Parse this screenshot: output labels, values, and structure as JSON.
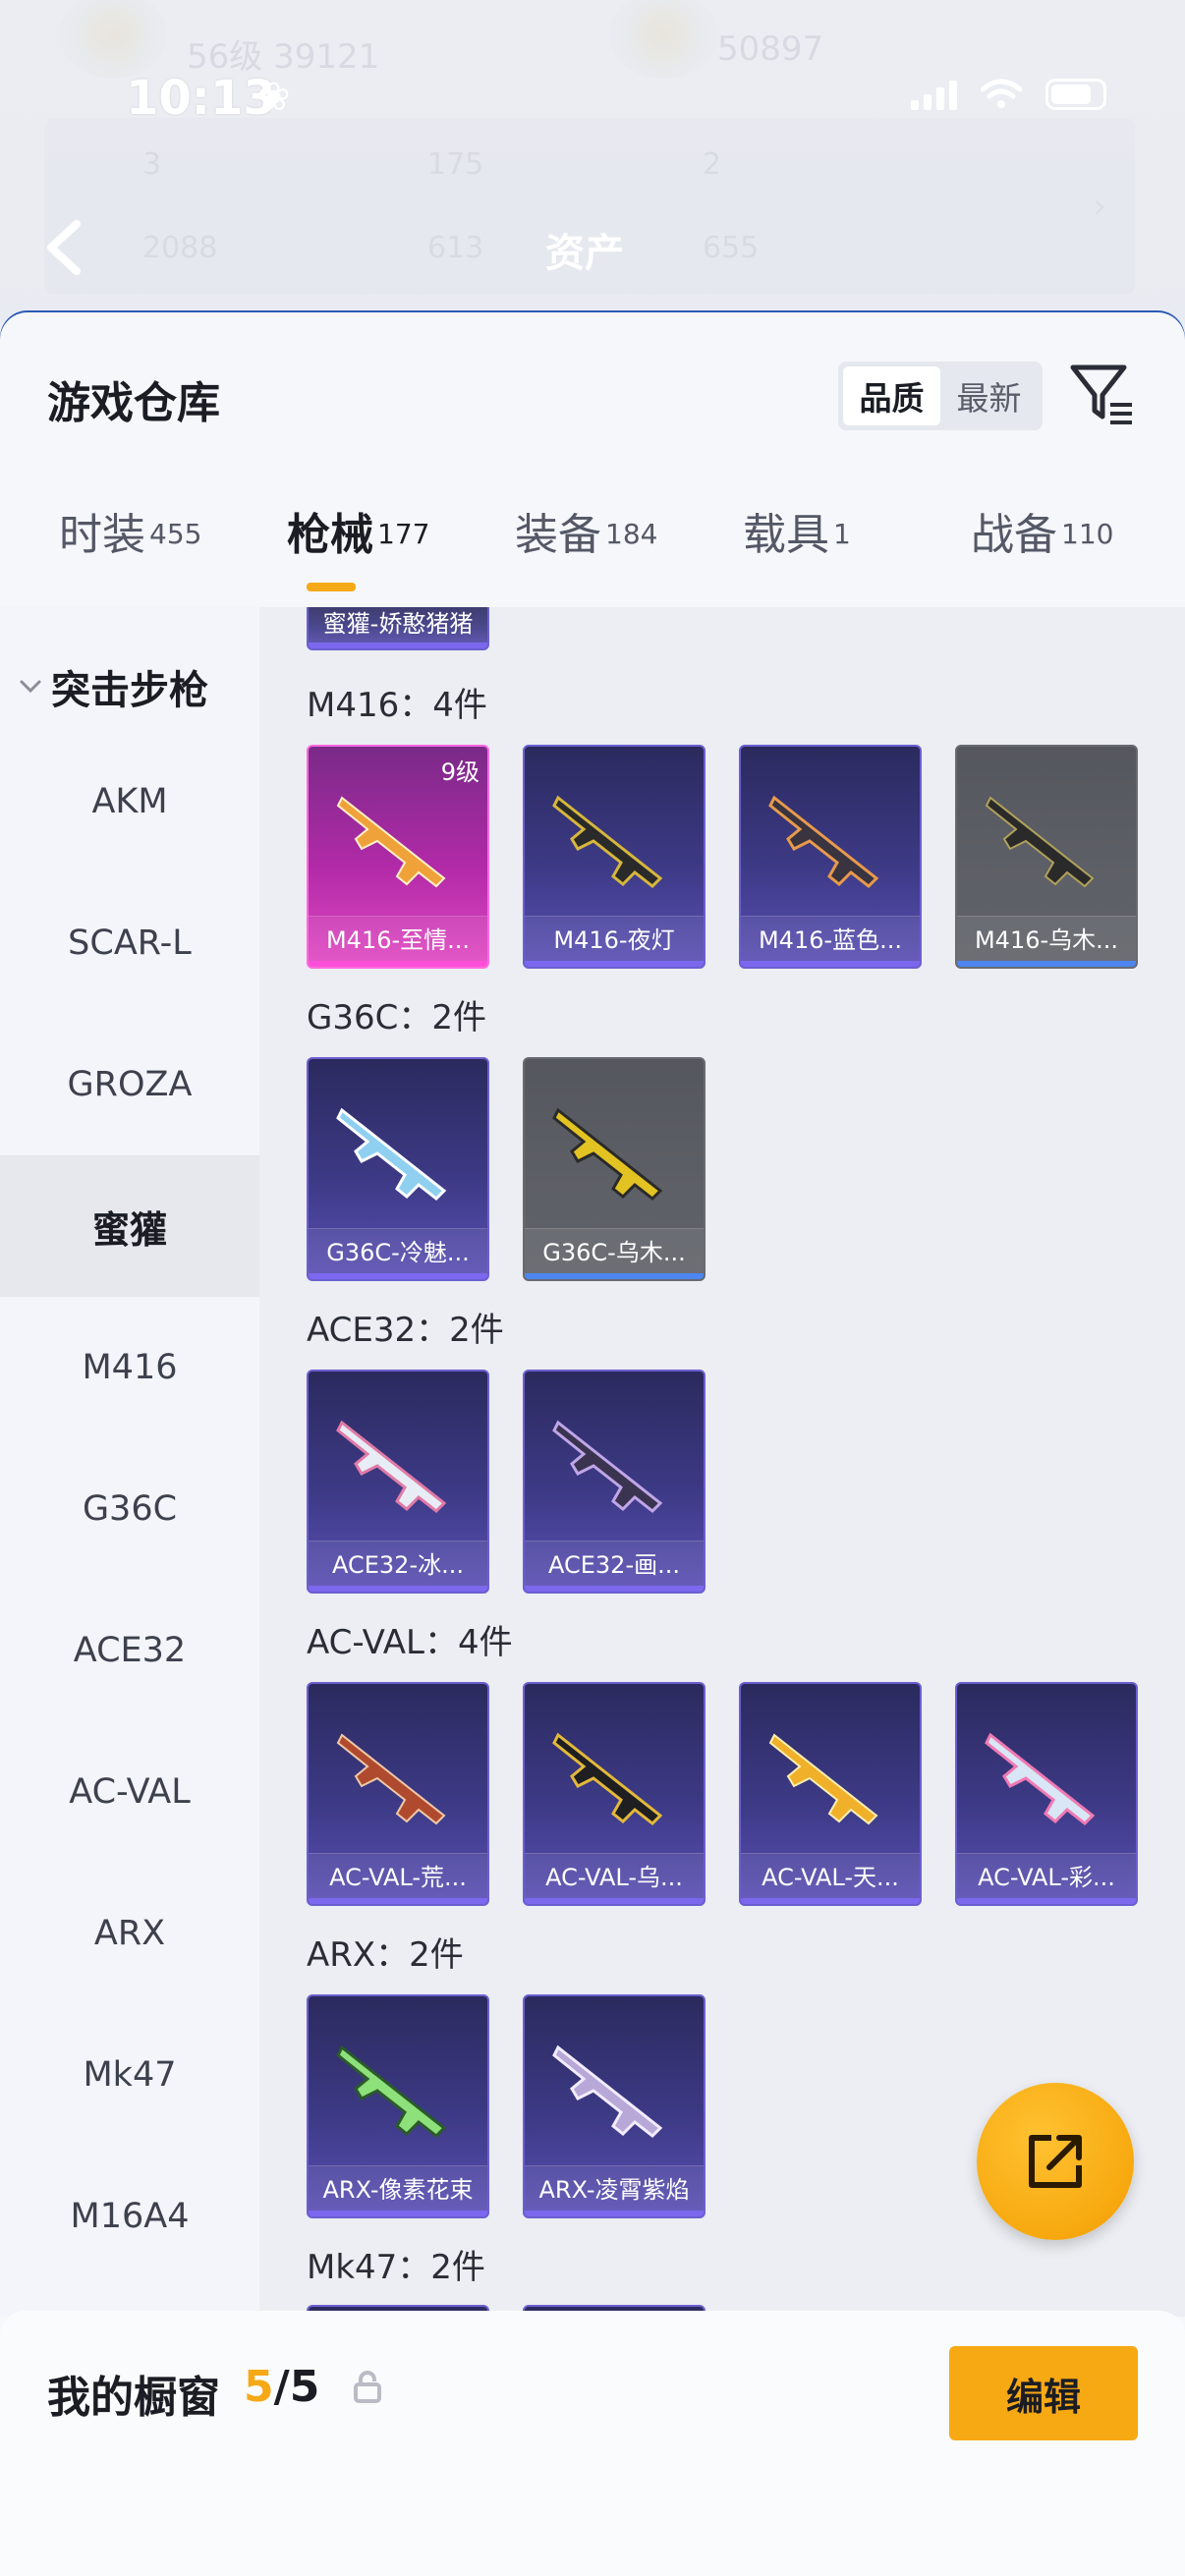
{
  "status_bar": {
    "time": "10:13"
  },
  "background": {
    "player1_stats": "56级  39121",
    "player2_stats": "50897",
    "stats_row1": [
      "3",
      "175",
      "2"
    ],
    "stats_row2": [
      "2088",
      "613",
      "655"
    ],
    "title": "资产"
  },
  "sheet": {
    "title": "游戏仓库",
    "sort_options": [
      "品质",
      "最新"
    ],
    "sort_active": "品质",
    "category_tabs": [
      {
        "label": "时装",
        "count": "455"
      },
      {
        "label": "枪械",
        "count": "177"
      },
      {
        "label": "装备",
        "count": "184"
      },
      {
        "label": "载具",
        "count": "1"
      },
      {
        "label": "战备",
        "count": "110"
      }
    ],
    "active_tab": "枪械"
  },
  "sidebar": {
    "header": "突击步枪",
    "items": [
      "AKM",
      "SCAR-L",
      "GROZA",
      "蜜獾",
      "M416",
      "G36C",
      "ACE32",
      "AC-VAL",
      "ARX",
      "Mk47",
      "M16A4"
    ],
    "active_item": "蜜獾"
  },
  "top_partial_card": "蜜獾-娇憨猪猪",
  "groups": [
    {
      "title": "M416：4件",
      "items": [
        {
          "name": "M416-至情...",
          "level": "9级",
          "rarity": "pink"
        },
        {
          "name": "M416-夜灯",
          "rarity": "purple"
        },
        {
          "name": "M416-蓝色...",
          "rarity": "purple"
        },
        {
          "name": "M416-乌木...",
          "rarity": "grey"
        }
      ]
    },
    {
      "title": "G36C：2件",
      "items": [
        {
          "name": "G36C-冷魅...",
          "rarity": "purple"
        },
        {
          "name": "G36C-乌木...",
          "rarity": "grey"
        }
      ]
    },
    {
      "title": "ACE32：2件",
      "items": [
        {
          "name": "ACE32-冰...",
          "rarity": "purple"
        },
        {
          "name": "ACE32-画...",
          "rarity": "purple"
        }
      ]
    },
    {
      "title": "AC-VAL：4件",
      "items": [
        {
          "name": "AC-VAL-荒...",
          "rarity": "purple"
        },
        {
          "name": "AC-VAL-乌...",
          "rarity": "purple"
        },
        {
          "name": "AC-VAL-天...",
          "rarity": "purple"
        },
        {
          "name": "AC-VAL-彩...",
          "rarity": "purple"
        }
      ]
    },
    {
      "title": "ARX：2件",
      "items": [
        {
          "name": "ARX-像素花束",
          "rarity": "purple"
        },
        {
          "name": "ARX-凌霄紫焰",
          "rarity": "purple"
        }
      ]
    },
    {
      "title": "Mk47：2件",
      "items": []
    }
  ],
  "bottom_bar": {
    "label": "我的橱窗",
    "count_current": "5",
    "count_total": "/5",
    "edit_label": "编辑"
  },
  "colors": {
    "accent": "#f5a917",
    "card_purple": "#3d3a86",
    "card_pink": "#b22aa8",
    "card_grey": "#5e6067"
  }
}
